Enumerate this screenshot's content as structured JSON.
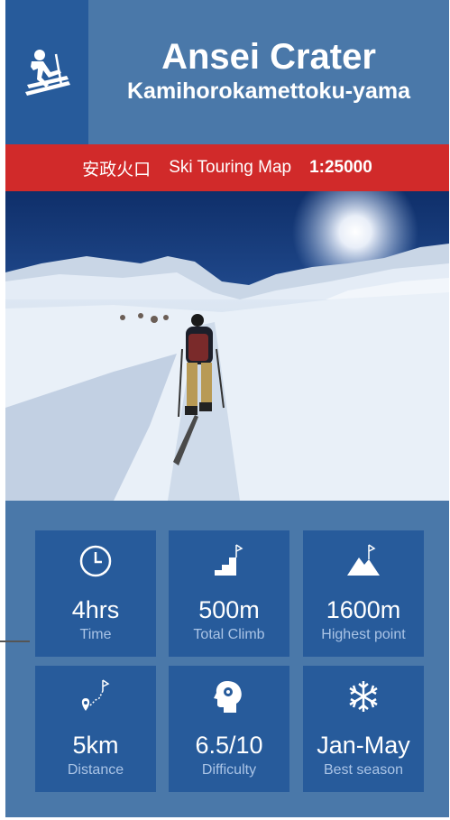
{
  "header": {
    "title": "Ansei Crater",
    "subtitle": "Kamihorokamettoku-yama",
    "icon": "ski-touring-icon"
  },
  "banner": {
    "japanese_name": "安政火口",
    "map_type": "Ski Touring Map",
    "scale": "1:25000",
    "color": "#d12a2a"
  },
  "photo": {
    "subject": "ski-tourer-skinning-up-snow-slope"
  },
  "stats": [
    {
      "value": "4hrs",
      "label": "Time",
      "icon": "clock-icon"
    },
    {
      "value": "500m",
      "label": "Total Climb",
      "icon": "stairs-flag-icon"
    },
    {
      "value": "1600m",
      "label": "Highest point",
      "icon": "mountain-flag-icon"
    },
    {
      "value": "5km",
      "label": "Distance",
      "icon": "route-pin-icon"
    },
    {
      "value": "6.5/10",
      "label": "Difficulty",
      "icon": "head-gear-icon"
    },
    {
      "value": "Jan-May",
      "label": "Best season",
      "icon": "snowflake-icon"
    }
  ],
  "colors": {
    "panel": "#4a78a9",
    "tile": "#275b9b",
    "accent": "#d12a2a"
  }
}
